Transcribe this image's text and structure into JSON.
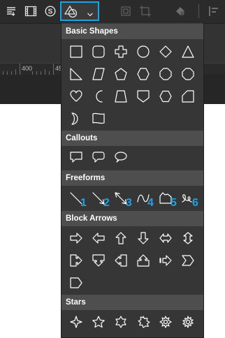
{
  "toolbar": {
    "icons": [
      "menu-list-icon",
      "film-icon",
      "s-circle-icon",
      "shapes-icon",
      "chevron-down-icon",
      "crop-frame-icon",
      "crop-icon",
      "paint-fill-icon",
      "align-icon"
    ]
  },
  "ruler": {
    "marks": [
      "400",
      "45"
    ]
  },
  "panel": {
    "accent_color": "#1aa3e8",
    "sections": {
      "basic_shapes": {
        "title": "Basic Shapes"
      },
      "callouts": {
        "title": "Callouts"
      },
      "freeforms": {
        "title": "Freeforms",
        "markers": [
          "1",
          "2",
          "3",
          "4",
          "5",
          "6"
        ]
      },
      "block_arrows": {
        "title": "Block Arrows"
      },
      "stars": {
        "title": "Stars"
      }
    }
  }
}
